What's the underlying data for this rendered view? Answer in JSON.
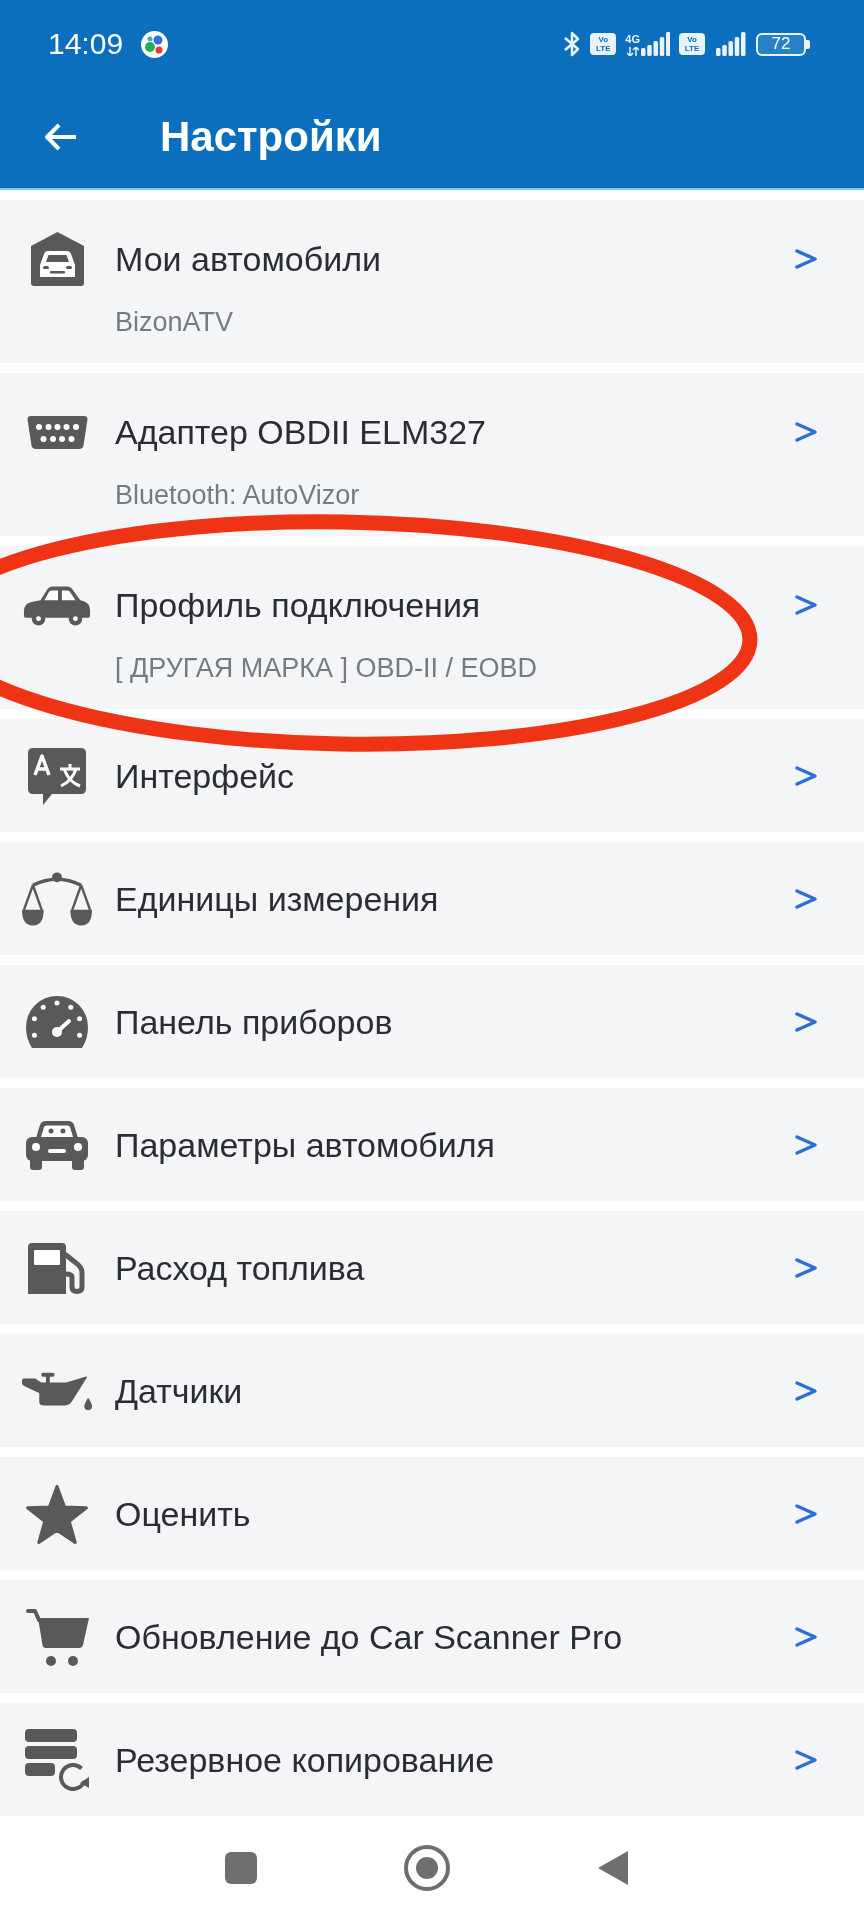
{
  "status_bar": {
    "time": "14:09",
    "sims": [
      {
        "volte": [
          "Vo",
          "LTE"
        ],
        "network": "4G"
      },
      {
        "volte": [
          "Vo",
          "LTE"
        ]
      }
    ],
    "battery": "72"
  },
  "toolbar": {
    "title": "Настройки"
  },
  "settings": [
    {
      "title": "Мои автомобили",
      "subtitle": "BizonATV"
    },
    {
      "title": "Адаптер OBDII ELM327",
      "subtitle": "Bluetooth: AutoVizor"
    },
    {
      "title": "Профиль подключения",
      "subtitle": "[ ДРУГАЯ МАРКА ] OBD-II / EOBD"
    },
    {
      "title": "Интерфейс"
    },
    {
      "title": "Единицы измерения"
    },
    {
      "title": "Панель приборов"
    },
    {
      "title": "Параметры автомобиля"
    },
    {
      "title": "Расход топлива"
    },
    {
      "title": "Датчики"
    },
    {
      "title": "Оценить"
    },
    {
      "title": "Обновление до Car Scanner Pro"
    },
    {
      "title": "Резервное копирование"
    }
  ]
}
